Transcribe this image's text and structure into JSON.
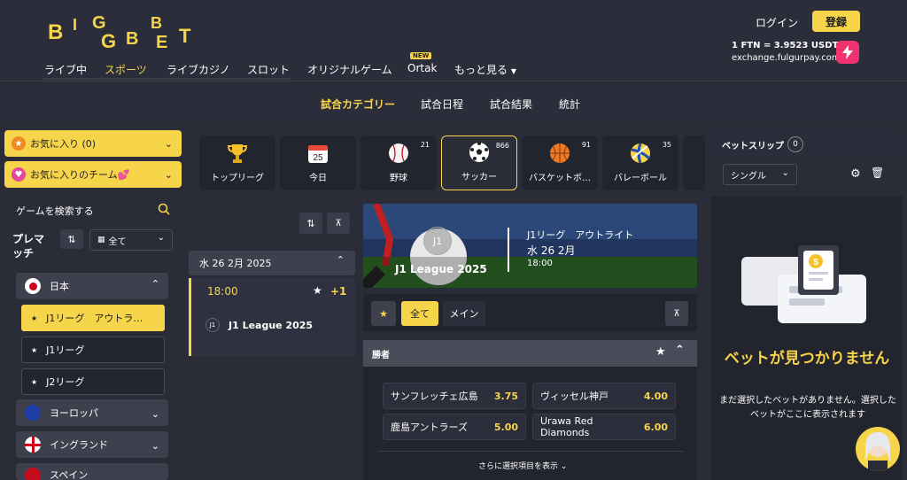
{
  "header": {
    "logo_line1": "BIGBET",
    "nav": [
      "ライブ中",
      "スポーツ",
      "ライブカジノ",
      "スロット",
      "オリジナルゲーム",
      "Ortak",
      "もっと見る"
    ],
    "nav_active": "スポーツ",
    "new_badge": "NEW",
    "login": "ログイン",
    "register": "登録",
    "ftn_rate": "1 FTN = 3.9523 USDT",
    "ftn_site": "exchange.fulgurpay.com"
  },
  "subnav": [
    "試合カテゴリー",
    "試合日程",
    "試合結果",
    "統計"
  ],
  "sidebar": {
    "favorites": "お気に入り (0)",
    "favorite_teams": "お気に入りのチーム💕",
    "search": "ゲームを検索する",
    "pre_match": "プレマッチ",
    "filter": "全て",
    "countries": [
      {
        "name": "日本",
        "leagues": [
          "J1リーグ　アウトラ…",
          "J1リーグ",
          "J2リーグ"
        ]
      },
      {
        "name": "ヨーロッパ"
      },
      {
        "name": "イングランド"
      },
      {
        "name": "スペイン"
      }
    ]
  },
  "categories": [
    {
      "label": "トップリーグ",
      "icon": "trophy-icon",
      "count": ""
    },
    {
      "label": "今日",
      "icon": "calendar-icon",
      "count": "",
      "day": "25"
    },
    {
      "label": "野球",
      "icon": "baseball-icon",
      "count": "21"
    },
    {
      "label": "サッカー",
      "icon": "soccer-ball-icon",
      "count": "866"
    },
    {
      "label": "バスケットボ…",
      "icon": "basketball-icon",
      "count": "91"
    },
    {
      "label": "バレーボール",
      "icon": "volleyball-icon",
      "count": "35"
    }
  ],
  "match_list": {
    "date": "水 26 2月 2025",
    "time": "18:00",
    "plus": "+1",
    "league_badge": "J1",
    "league": "J1 League 2025"
  },
  "banner": {
    "badge": "J1",
    "league": "J1 League 2025",
    "title": "J1リーグ　アウトライト",
    "date": "水 26 2月",
    "time": "18:00"
  },
  "market": {
    "tabs": [
      "全て",
      "メイン"
    ],
    "header": "勝者",
    "odds": [
      {
        "team": "サンフレッチェ広島",
        "odd": "3.75"
      },
      {
        "team": "ヴィッセル神戸",
        "odd": "4.00"
      },
      {
        "team": "鹿島アントラーズ",
        "odd": "5.00"
      },
      {
        "team": "Urawa Red Diamonds",
        "odd": "6.00"
      }
    ],
    "more": "さらに選択項目を表示"
  },
  "betslip": {
    "title": "ベットスリップ",
    "count": "0",
    "type": "シングル",
    "empty_title": "ベットが見つかりません",
    "empty_desc": "まだ選択したベットがありません。選択したベットがここに表示されます"
  }
}
